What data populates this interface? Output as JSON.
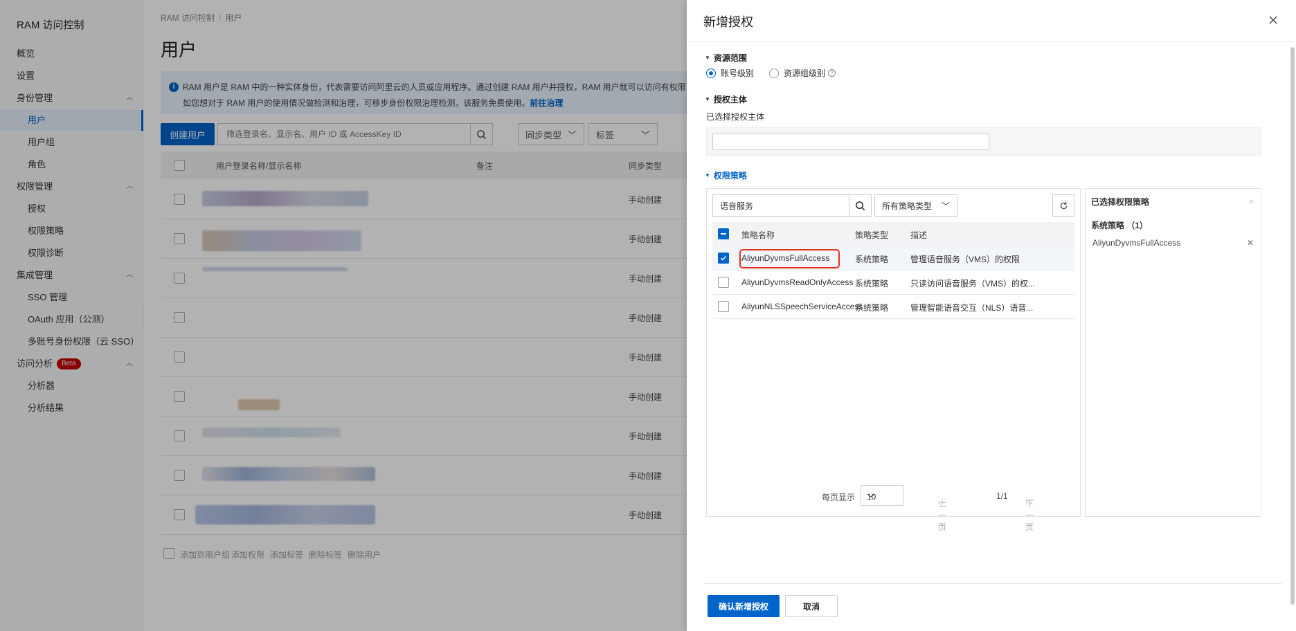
{
  "console": {
    "brand": "RAM 访问控制",
    "nav": [
      {
        "label": "概览",
        "level": "top"
      },
      {
        "label": "设置",
        "level": "top"
      },
      {
        "label": "身份管理",
        "level": "top",
        "expandable": true
      },
      {
        "label": "用户",
        "level": "sub",
        "active": true
      },
      {
        "label": "用户组",
        "level": "sub"
      },
      {
        "label": "角色",
        "level": "sub"
      },
      {
        "label": "权限管理",
        "level": "top",
        "expandable": true
      },
      {
        "label": "授权",
        "level": "sub"
      },
      {
        "label": "权限策略",
        "level": "sub"
      },
      {
        "label": "权限诊断",
        "level": "sub"
      },
      {
        "label": "集成管理",
        "level": "top",
        "expandable": true
      },
      {
        "label": "SSO 管理",
        "level": "sub"
      },
      {
        "label": "OAuth 应用（公测）",
        "level": "sub"
      },
      {
        "label": "多账号身份权限（云 SSO）",
        "level": "sub"
      },
      {
        "label": "访问分析",
        "level": "top",
        "expandable": true,
        "badge": "Beta"
      },
      {
        "label": "分析器",
        "level": "sub"
      },
      {
        "label": "分析结果",
        "level": "sub"
      }
    ],
    "breadcrumb": [
      "RAM 访问控制",
      "用户"
    ],
    "page_title": "用户",
    "banner": {
      "line1": "RAM 用户是 RAM 中的一种实体身份，代表需要访问阿里云的人员或应用程序。通过创建 RAM 用户并授权，RAM 用户就可以访问有权限",
      "line2": "如您想对于 RAM 用户的使用情况做检测和治理，可移步身份权限治理检测，该服务免费使用。",
      "link": "前往治理"
    },
    "create_button": "创建用户",
    "search_placeholder": "筛选登录名、显示名、用户 ID 或 AccessKey ID",
    "filter_sync": "同步类型",
    "filter_tag": "标签",
    "columns": [
      "用户登录名称/显示名称",
      "备注",
      "同步类型"
    ],
    "rows": [
      "手动创建",
      "手动创建",
      "手动创建",
      "手动创建",
      "手动创建",
      "手动创建",
      "手动创建",
      "手动创建",
      "手动创建"
    ],
    "bulk_actions": [
      "添加到用户组",
      "添加权限",
      "添加标签",
      "删除标签",
      "删除用户"
    ]
  },
  "drawer": {
    "title": "新增授权",
    "scope": {
      "title": "资源范围",
      "options": [
        {
          "label": "账号级别",
          "selected": true
        },
        {
          "label": "资源组级别",
          "selected": false
        }
      ]
    },
    "principal": {
      "title": "授权主体",
      "label": "已选择授权主体"
    },
    "policy": {
      "title": "权限策略",
      "search_value": "语音服务",
      "type_filter": "所有策略类型",
      "columns": [
        "策略名称",
        "策略类型",
        "描述"
      ],
      "rows": [
        {
          "name": "AliyunDyvmsFullAccess",
          "type": "系统策略",
          "desc": "管理语音服务（VMS）的权限",
          "checked": true
        },
        {
          "name": "AliyunDyvmsReadOnlyAccess",
          "type": "系统策略",
          "desc": "只读访问语音服务（VMS）的权...",
          "checked": false
        },
        {
          "name": "AliyunNLSSpeechServiceAccess",
          "type": "系统策略",
          "desc": "管理智能语音交互（NLS）语音...",
          "checked": false
        }
      ],
      "pager": {
        "per_page_label": "每页显示",
        "per_page": "10",
        "prev": "上一页",
        "page": "1/1",
        "next": "下一页"
      }
    },
    "selected": {
      "title": "已选择权限策略",
      "group": "系统策略 （1）",
      "items": [
        "AliyunDyvmsFullAccess"
      ]
    },
    "confirm": "确认新增授权",
    "cancel": "取消"
  },
  "colors": {
    "primary": "#0064c8",
    "highlight": "#e0311e",
    "beta": "#c40000"
  }
}
